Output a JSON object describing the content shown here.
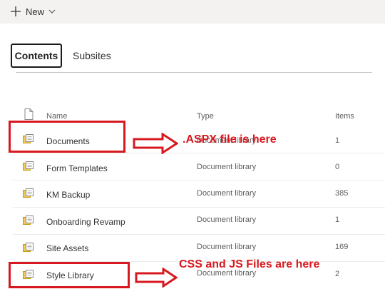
{
  "toolbar": {
    "new_label": "New"
  },
  "tabs": {
    "contents": "Contents",
    "subsites": "Subsites"
  },
  "columns": {
    "name": "Name",
    "type": "Type",
    "items": "Items"
  },
  "rows": [
    {
      "name": "Documents",
      "type": "Document library",
      "items": "1"
    },
    {
      "name": "Form Templates",
      "type": "Document library",
      "items": "0"
    },
    {
      "name": "KM Backup",
      "type": "Document library",
      "items": "385"
    },
    {
      "name": "Onboarding Revamp",
      "type": "Document library",
      "items": "1"
    },
    {
      "name": "Site Assets",
      "type": "Document library",
      "items": "169"
    },
    {
      "name": "Style Library",
      "type": "Document library",
      "items": "2"
    }
  ],
  "annotations": {
    "aspx": ".ASPX file is here",
    "css_js": "CSS and JS Files are here"
  },
  "colors": {
    "annotation_red": "#d7191f",
    "toolbar_bg": "#f3f2f1",
    "accent": "#0078d4"
  }
}
